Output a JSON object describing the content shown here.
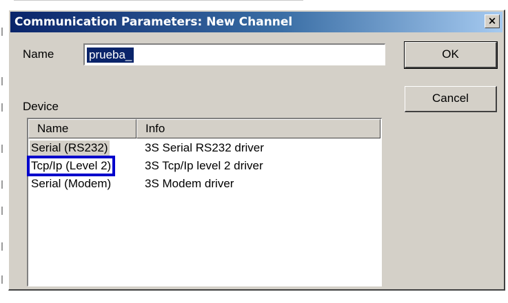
{
  "window": {
    "title": "Communication Parameters: New Channel",
    "close_label": "×"
  },
  "form": {
    "name_label": "Name",
    "name_value": "prueba_",
    "device_label": "Device"
  },
  "buttons": {
    "ok": "OK",
    "cancel": "Cancel"
  },
  "device_list": {
    "columns": [
      "Name",
      "Info"
    ],
    "rows": [
      {
        "name": "Serial (RS232)",
        "info": "3S Serial RS232 driver",
        "selected": true
      },
      {
        "name": "Tcp/Ip (Level 2)",
        "info": "3S Tcp/Ip level 2 driver",
        "highlighted": true
      },
      {
        "name": "Serial (Modem)",
        "info": "3S Modem driver"
      }
    ]
  },
  "colors": {
    "title_gradient_start": "#0a246a",
    "dialog_face": "#d4d0c8",
    "highlight_box": "#0000cc",
    "text_selection": "#0a246a"
  }
}
